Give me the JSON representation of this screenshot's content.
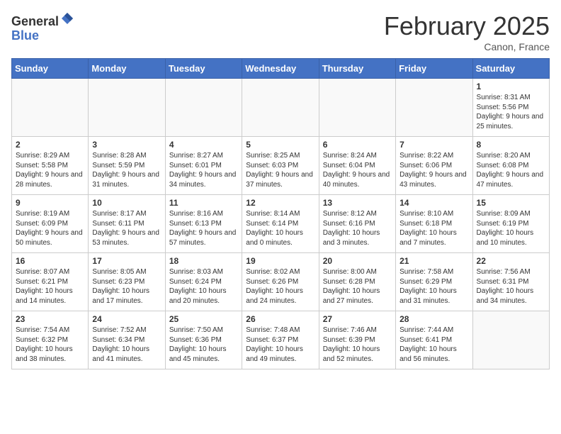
{
  "header": {
    "logo_general": "General",
    "logo_blue": "Blue",
    "month_title": "February 2025",
    "location": "Canon, France"
  },
  "days_of_week": [
    "Sunday",
    "Monday",
    "Tuesday",
    "Wednesday",
    "Thursday",
    "Friday",
    "Saturday"
  ],
  "weeks": [
    [
      {
        "day": "",
        "info": ""
      },
      {
        "day": "",
        "info": ""
      },
      {
        "day": "",
        "info": ""
      },
      {
        "day": "",
        "info": ""
      },
      {
        "day": "",
        "info": ""
      },
      {
        "day": "",
        "info": ""
      },
      {
        "day": "1",
        "info": "Sunrise: 8:31 AM\nSunset: 5:56 PM\nDaylight: 9 hours and 25 minutes."
      }
    ],
    [
      {
        "day": "2",
        "info": "Sunrise: 8:29 AM\nSunset: 5:58 PM\nDaylight: 9 hours and 28 minutes."
      },
      {
        "day": "3",
        "info": "Sunrise: 8:28 AM\nSunset: 5:59 PM\nDaylight: 9 hours and 31 minutes."
      },
      {
        "day": "4",
        "info": "Sunrise: 8:27 AM\nSunset: 6:01 PM\nDaylight: 9 hours and 34 minutes."
      },
      {
        "day": "5",
        "info": "Sunrise: 8:25 AM\nSunset: 6:03 PM\nDaylight: 9 hours and 37 minutes."
      },
      {
        "day": "6",
        "info": "Sunrise: 8:24 AM\nSunset: 6:04 PM\nDaylight: 9 hours and 40 minutes."
      },
      {
        "day": "7",
        "info": "Sunrise: 8:22 AM\nSunset: 6:06 PM\nDaylight: 9 hours and 43 minutes."
      },
      {
        "day": "8",
        "info": "Sunrise: 8:20 AM\nSunset: 6:08 PM\nDaylight: 9 hours and 47 minutes."
      }
    ],
    [
      {
        "day": "9",
        "info": "Sunrise: 8:19 AM\nSunset: 6:09 PM\nDaylight: 9 hours and 50 minutes."
      },
      {
        "day": "10",
        "info": "Sunrise: 8:17 AM\nSunset: 6:11 PM\nDaylight: 9 hours and 53 minutes."
      },
      {
        "day": "11",
        "info": "Sunrise: 8:16 AM\nSunset: 6:13 PM\nDaylight: 9 hours and 57 minutes."
      },
      {
        "day": "12",
        "info": "Sunrise: 8:14 AM\nSunset: 6:14 PM\nDaylight: 10 hours and 0 minutes."
      },
      {
        "day": "13",
        "info": "Sunrise: 8:12 AM\nSunset: 6:16 PM\nDaylight: 10 hours and 3 minutes."
      },
      {
        "day": "14",
        "info": "Sunrise: 8:10 AM\nSunset: 6:18 PM\nDaylight: 10 hours and 7 minutes."
      },
      {
        "day": "15",
        "info": "Sunrise: 8:09 AM\nSunset: 6:19 PM\nDaylight: 10 hours and 10 minutes."
      }
    ],
    [
      {
        "day": "16",
        "info": "Sunrise: 8:07 AM\nSunset: 6:21 PM\nDaylight: 10 hours and 14 minutes."
      },
      {
        "day": "17",
        "info": "Sunrise: 8:05 AM\nSunset: 6:23 PM\nDaylight: 10 hours and 17 minutes."
      },
      {
        "day": "18",
        "info": "Sunrise: 8:03 AM\nSunset: 6:24 PM\nDaylight: 10 hours and 20 minutes."
      },
      {
        "day": "19",
        "info": "Sunrise: 8:02 AM\nSunset: 6:26 PM\nDaylight: 10 hours and 24 minutes."
      },
      {
        "day": "20",
        "info": "Sunrise: 8:00 AM\nSunset: 6:28 PM\nDaylight: 10 hours and 27 minutes."
      },
      {
        "day": "21",
        "info": "Sunrise: 7:58 AM\nSunset: 6:29 PM\nDaylight: 10 hours and 31 minutes."
      },
      {
        "day": "22",
        "info": "Sunrise: 7:56 AM\nSunset: 6:31 PM\nDaylight: 10 hours and 34 minutes."
      }
    ],
    [
      {
        "day": "23",
        "info": "Sunrise: 7:54 AM\nSunset: 6:32 PM\nDaylight: 10 hours and 38 minutes."
      },
      {
        "day": "24",
        "info": "Sunrise: 7:52 AM\nSunset: 6:34 PM\nDaylight: 10 hours and 41 minutes."
      },
      {
        "day": "25",
        "info": "Sunrise: 7:50 AM\nSunset: 6:36 PM\nDaylight: 10 hours and 45 minutes."
      },
      {
        "day": "26",
        "info": "Sunrise: 7:48 AM\nSunset: 6:37 PM\nDaylight: 10 hours and 49 minutes."
      },
      {
        "day": "27",
        "info": "Sunrise: 7:46 AM\nSunset: 6:39 PM\nDaylight: 10 hours and 52 minutes."
      },
      {
        "day": "28",
        "info": "Sunrise: 7:44 AM\nSunset: 6:41 PM\nDaylight: 10 hours and 56 minutes."
      },
      {
        "day": "",
        "info": ""
      }
    ]
  ]
}
